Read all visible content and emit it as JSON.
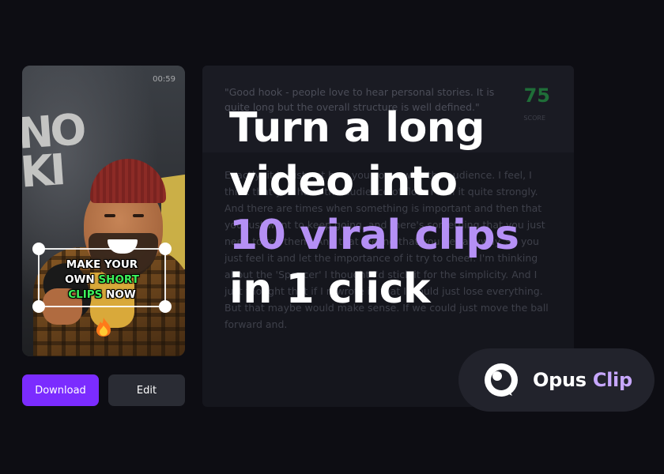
{
  "video": {
    "timestamp": "00:59",
    "caption": {
      "line1": "MAKE YOUR",
      "line2_prefix": "OWN ",
      "line2_highlight": "SHORT",
      "line3_highlight": "CLIPS",
      "line3_suffix": " NOW",
      "highlight_color": "#3ef05a"
    },
    "emoji_icon": "fire-icon"
  },
  "actions": {
    "download_label": "Download",
    "edit_label": "Edit",
    "download_color": "#7b2cff"
  },
  "transcript": {
    "hook": "\"Good hook - people love to hear personal stories. It is quite long but the overall structure is well defined.\"",
    "score": "75",
    "score_label": "SCORE",
    "body": "Exactly, it is just not how you come with the audience. I feel, I think that you have the audience of flow. I feel it quite strongly. And there are times when something is important and then that you just want to keep going, and there's something that you just need to tell them. And that feeling that you get anyway. So you just feel it and let the importance of it try to cheer. I'm thinking about the 'Spencer' I thought I'd stick it for the simplicity. And I just thought that if I rewrote it, that I would just lose everything. But that maybe would make sense. If we could just move the ball forward and."
  },
  "headline": {
    "line1": "Turn a long",
    "line2": "video into",
    "line3_highlight": "10 viral clips",
    "line4": "in 1 click",
    "highlight_color": "#b590f5"
  },
  "brand": {
    "name_part1": "Opus ",
    "name_part2": "Clip",
    "logo_icon": "opus-logo-icon"
  }
}
